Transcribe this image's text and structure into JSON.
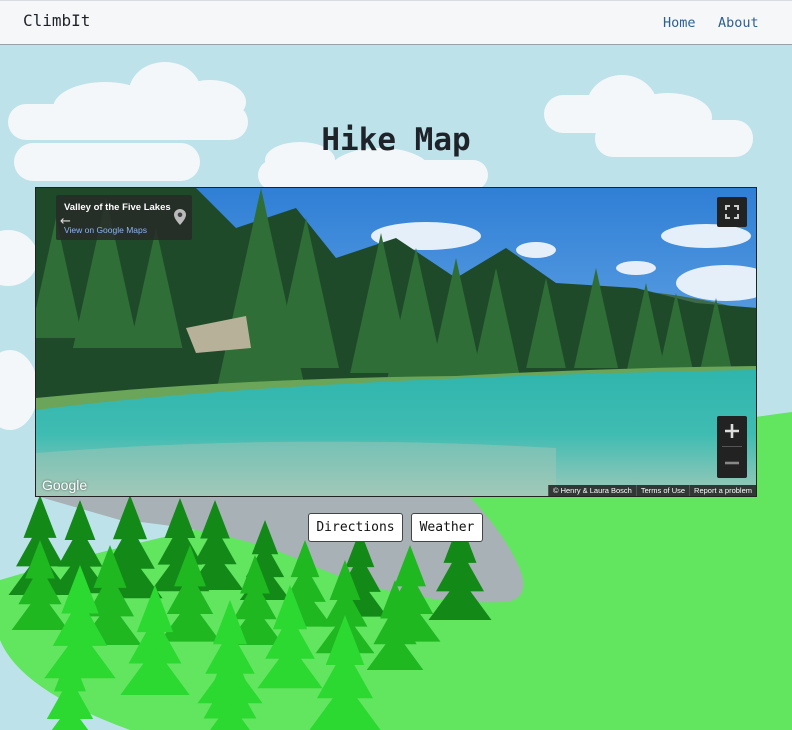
{
  "navbar": {
    "brand": "ClimbIt",
    "links": [
      {
        "label": "Home"
      },
      {
        "label": "About"
      }
    ]
  },
  "page": {
    "title": "Hike Map"
  },
  "map": {
    "place_name": "Valley of the Five Lakes",
    "view_link": "View on Google Maps",
    "logo": "Google",
    "attribution": [
      "© Henry & Laura Bosch",
      "Terms of Use",
      "Report a problem"
    ],
    "icons": [
      "back-arrow-icon",
      "map-pin-icon",
      "fullscreen-icon",
      "zoom-in-icon",
      "zoom-out-icon"
    ]
  },
  "actions": {
    "directions_label": "Directions",
    "weather_label": "Weather"
  },
  "colors": {
    "sky": "#bde2ea",
    "cloud": "#f3f7f9",
    "grass": "#62e55f",
    "mountain": "#a7b1b6",
    "tree_dark": "#138a18",
    "tree_mid": "#1fb820",
    "tree_light": "#2bd930",
    "lake": "#3fbcb2"
  }
}
